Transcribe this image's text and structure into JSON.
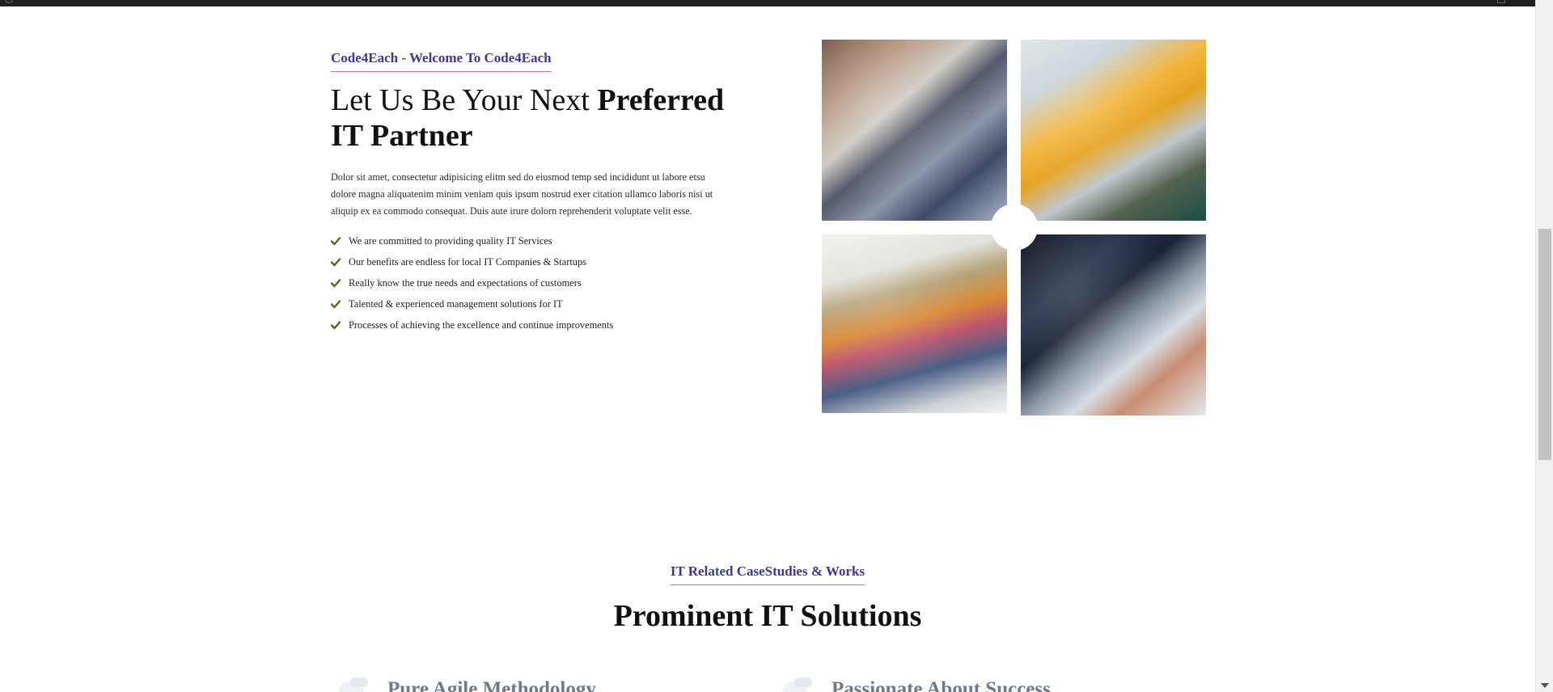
{
  "about": {
    "eyebrow": "Code4Each - Welcome To Code4Each",
    "headline_regular": "Let Us Be Your Next ",
    "headline_bold": "Preferred IT Partner",
    "description": "Dolor sit amet, consectetur adipisicing elitm sed do eiusmod temp sed incididunt ut labore etsu dolore magna aliquatenim minim veniam quis ipsum nostrud exer citation ullamco laboris nisi ut aliquip ex ea commodo consequat. Duis aute irure dolorn reprehenderit voluptate velit esse.",
    "check_icon": "check-icon",
    "features": [
      "We are committed to providing quality IT Services",
      "Our benefits are endless for local IT Companies & Startups",
      "Really know the true needs and expectations of customers",
      "Talented & experienced management solutions for IT",
      "Processes of achieving the excellence and continue improvements"
    ]
  },
  "gallery": {
    "photos": [
      "man-thinking-photo",
      "woman-at-laptop-photo",
      "woman-with-papers-photo",
      "laptop-code-photo"
    ]
  },
  "solutions": {
    "eyebrow": "IT Related CaseStudies & Works",
    "title": "Prominent IT Solutions",
    "cards": [
      {
        "title": "Pure Agile Methodology"
      },
      {
        "title": "Passionate About Success"
      }
    ]
  },
  "colors": {
    "accent_purple": "#3d3a8c",
    "accent_pink_underline": "#e0699a",
    "check_olive": "#6b5a22"
  }
}
